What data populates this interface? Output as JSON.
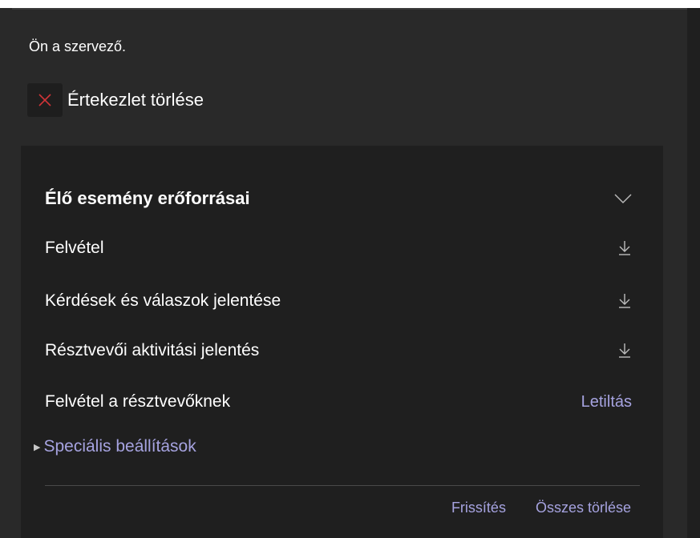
{
  "header": {
    "organizer_note": "Ön a szervező.",
    "delete_meeting_label": "Értekezlet törlése"
  },
  "resources": {
    "title": "Élő esemény erőforrásai",
    "items": [
      {
        "label": "Felvétel",
        "action_icon": "download-icon"
      },
      {
        "label": "Kérdések és válaszok jelentése",
        "action_icon": "download-icon"
      },
      {
        "label": "Résztvevői aktivitási jelentés",
        "action_icon": "download-icon"
      },
      {
        "label": "Felvétel a résztvevőknek",
        "action_label": "Letiltás"
      }
    ],
    "advanced_settings_label": "Speciális beállítások",
    "footer": {
      "refresh_label": "Frissítés",
      "delete_all_label": "Összes törlése"
    }
  },
  "colors": {
    "background": "#292929",
    "card_background": "#1f1f1f",
    "link": "#a6a3e0",
    "delete_icon": "#d13438"
  }
}
